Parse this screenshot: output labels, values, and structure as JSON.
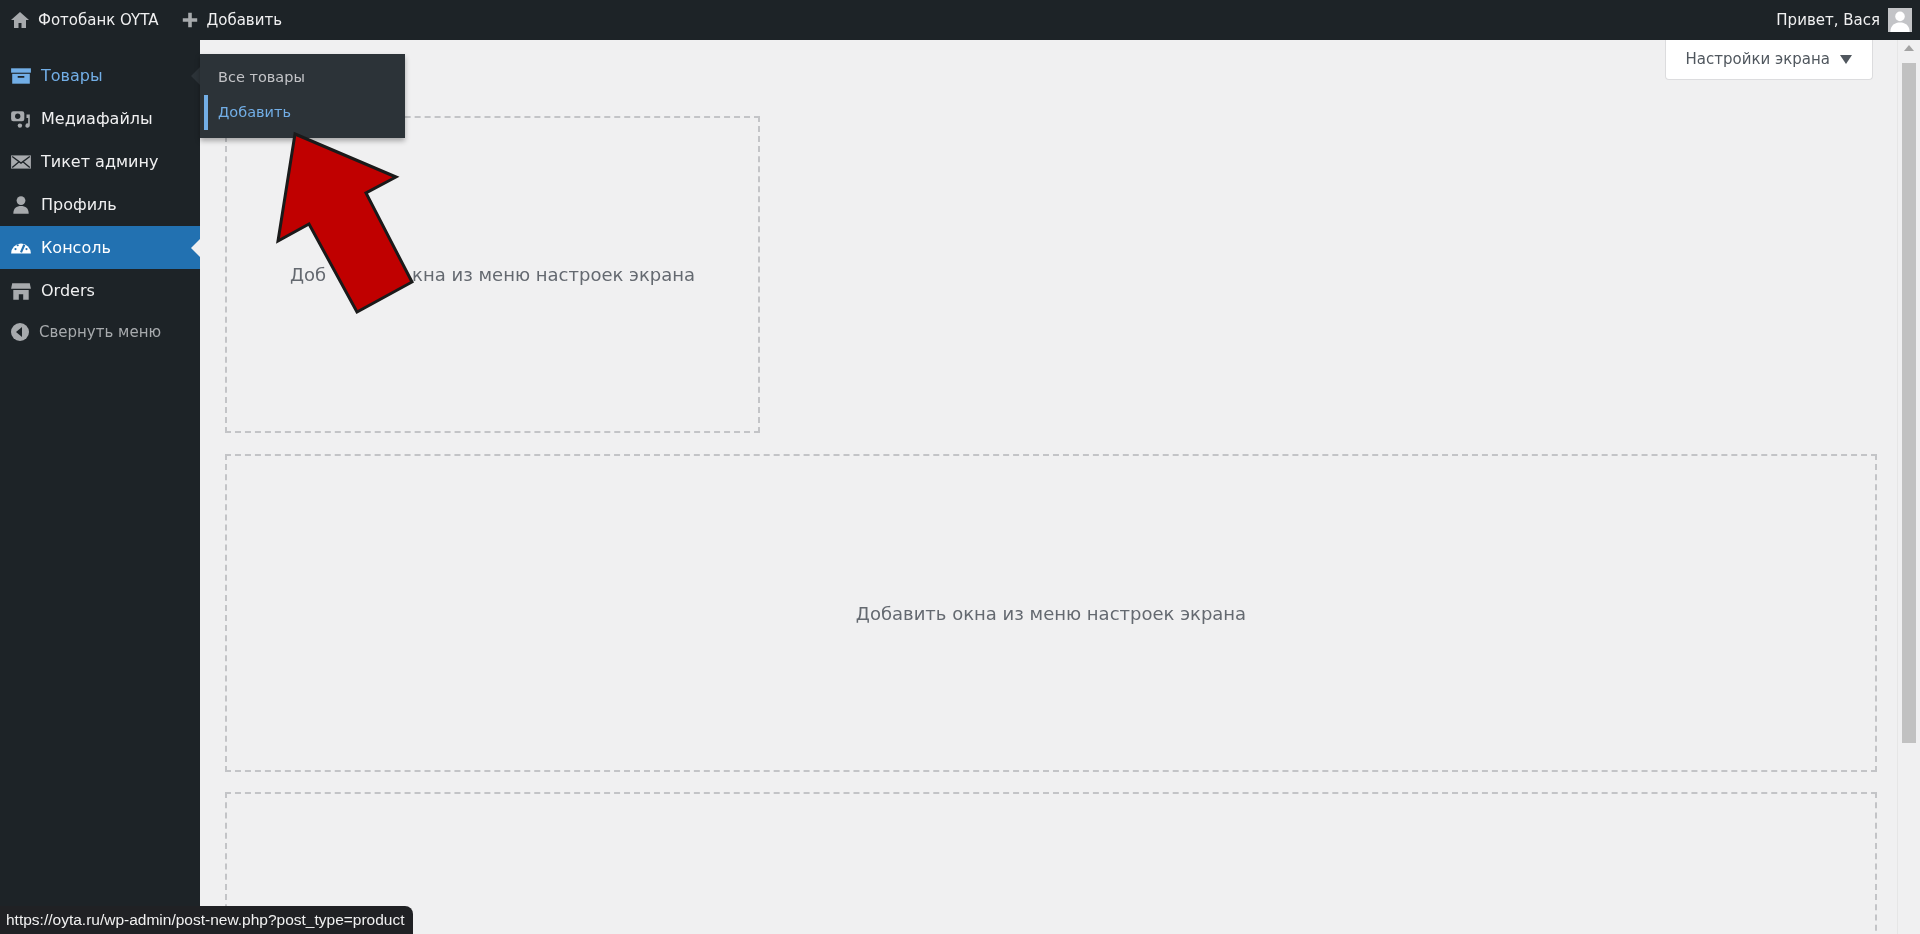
{
  "admin_bar": {
    "site_name": "Фотобанк OYTA",
    "new_label": "Добавить",
    "greeting": "Привет, Вася"
  },
  "sidebar": {
    "items": [
      {
        "label": "Товары",
        "hovered": true,
        "selected": false
      },
      {
        "label": "Медиафайлы",
        "hovered": false,
        "selected": false
      },
      {
        "label": "Тикет админу",
        "hovered": false,
        "selected": false
      },
      {
        "label": "Профиль",
        "hovered": false,
        "selected": false
      },
      {
        "label": "Консоль",
        "hovered": false,
        "selected": true
      },
      {
        "label": "Orders",
        "hovered": false,
        "selected": false
      }
    ],
    "collapse_label": "Свернуть меню"
  },
  "submenu": {
    "items": [
      {
        "label": "Все товары",
        "selected": false
      },
      {
        "label": "Добавить",
        "selected": true
      }
    ]
  },
  "screen_options": {
    "label": "Настройки экрана"
  },
  "boxes": [
    {
      "kind": "covered",
      "text_parts": [
        "Доб",
        "кна из меню настроек экрана"
      ]
    },
    {
      "kind": "text",
      "text": "Добавить окна из меню настроек экрана"
    },
    {
      "kind": "empty"
    }
  ],
  "annotation": {
    "kind": "arrow"
  },
  "status_url": "https://oyta.ru/wp-admin/post-new.php?post_type=product"
}
